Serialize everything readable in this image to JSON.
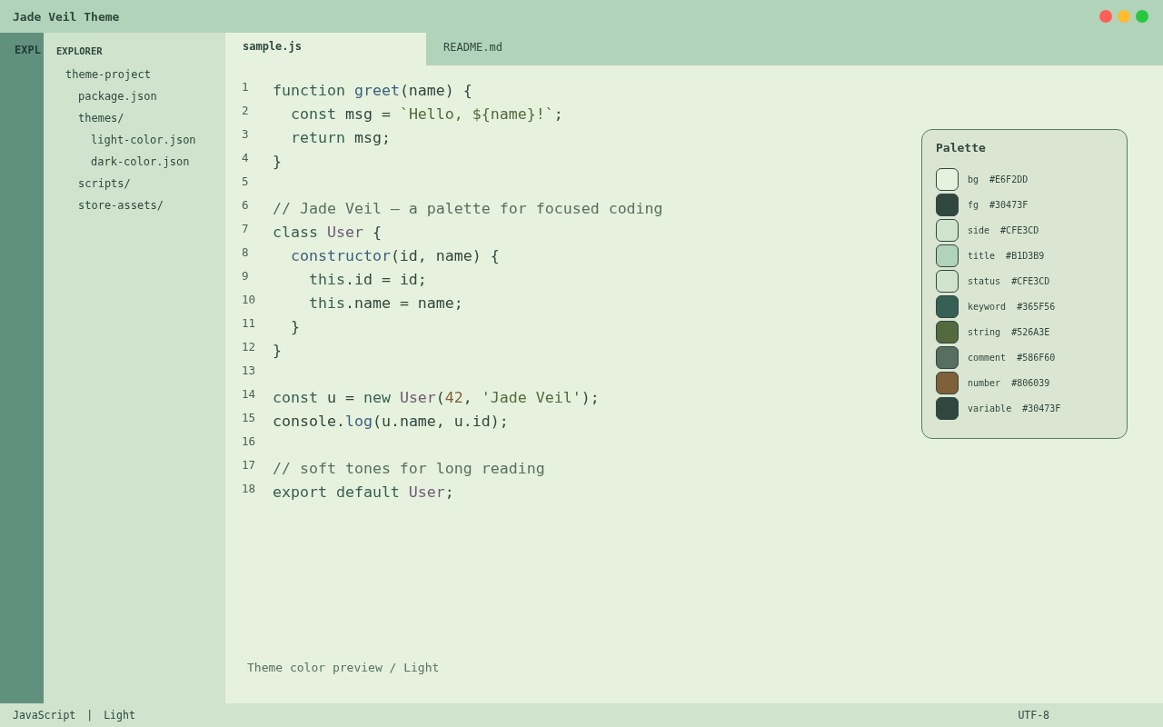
{
  "window": {
    "title": "Jade Veil Theme",
    "controls": [
      {
        "color": "#ff5f57"
      },
      {
        "color": "#febc2e"
      },
      {
        "color": "#28c840"
      }
    ]
  },
  "activity_bar": {
    "label": "EXPL"
  },
  "sidebar": {
    "heading": "EXPLORER",
    "items": [
      {
        "label": "theme-project",
        "children": [
          {
            "label": "package.json"
          },
          {
            "label": "themes/",
            "children": [
              {
                "label": "light-color.json"
              },
              {
                "label": "dark-color.json"
              }
            ]
          },
          {
            "label": "scripts/"
          },
          {
            "label": "store-assets/"
          }
        ]
      }
    ]
  },
  "tabs": [
    {
      "label": "sample.js",
      "selected": true
    },
    {
      "label": "README.md",
      "selected": false
    }
  ],
  "code": [
    {
      "number": "1",
      "tokens": [
        {
          "kind": "keyword",
          "text": "function "
        },
        {
          "kind": "function",
          "text": "greet"
        },
        {
          "kind": "plain",
          "text": "(name) {"
        }
      ]
    },
    {
      "number": "2",
      "tokens": [
        {
          "kind": "keyword",
          "text": "  const "
        },
        {
          "kind": "plain",
          "text": "msg = "
        },
        {
          "kind": "string",
          "text": "`Hello, ${name}!`"
        },
        {
          "kind": "plain",
          "text": ";"
        }
      ]
    },
    {
      "number": "3",
      "tokens": [
        {
          "kind": "keyword",
          "text": "  return "
        },
        {
          "kind": "plain",
          "text": "msg;"
        }
      ]
    },
    {
      "number": "4",
      "tokens": [
        {
          "kind": "plain",
          "text": "}"
        }
      ]
    },
    {
      "number": "5"
    },
    {
      "number": "6",
      "tokens": [
        {
          "kind": "comment",
          "text": "// Jade Veil — a palette for focused coding"
        }
      ]
    },
    {
      "number": "7",
      "tokens": [
        {
          "kind": "keyword",
          "text": "class "
        },
        {
          "kind": "class",
          "text": "User"
        },
        {
          "kind": "plain",
          "text": " {"
        }
      ]
    },
    {
      "number": "8",
      "tokens": [
        {
          "kind": "function",
          "text": "  constructor"
        },
        {
          "kind": "plain",
          "text": "(id, name) {"
        }
      ]
    },
    {
      "number": "9",
      "tokens": [
        {
          "kind": "keyword",
          "text": "    this"
        },
        {
          "kind": "plain",
          "text": ".id = id;"
        }
      ]
    },
    {
      "number": "10",
      "tokens": [
        {
          "kind": "keyword",
          "text": "    this"
        },
        {
          "kind": "plain",
          "text": ".name = name;"
        }
      ]
    },
    {
      "number": "11",
      "tokens": [
        {
          "kind": "plain",
          "text": "  }"
        }
      ]
    },
    {
      "number": "12",
      "tokens": [
        {
          "kind": "plain",
          "text": "}"
        }
      ]
    },
    {
      "number": "13"
    },
    {
      "number": "14",
      "tokens": [
        {
          "kind": "keyword",
          "text": "const "
        },
        {
          "kind": "plain",
          "text": "u = "
        },
        {
          "kind": "keyword",
          "text": "new "
        },
        {
          "kind": "class",
          "text": "User"
        },
        {
          "kind": "plain",
          "text": "("
        },
        {
          "kind": "number",
          "text": "42"
        },
        {
          "kind": "plain",
          "text": ", "
        },
        {
          "kind": "string",
          "text": "'Jade Veil'"
        },
        {
          "kind": "plain",
          "text": ");"
        }
      ]
    },
    {
      "number": "15",
      "tokens": [
        {
          "kind": "plain",
          "text": "console."
        },
        {
          "kind": "function",
          "text": "log"
        },
        {
          "kind": "plain",
          "text": "(u.name, u.id);"
        }
      ]
    },
    {
      "number": "16"
    },
    {
      "number": "17",
      "tokens": [
        {
          "kind": "comment",
          "text": "// soft tones for long reading"
        }
      ]
    },
    {
      "number": "18",
      "tokens": [
        {
          "kind": "keyword",
          "text": "export default "
        },
        {
          "kind": "class",
          "text": "User"
        },
        {
          "kind": "plain",
          "text": ";"
        }
      ]
    }
  ],
  "caption": "Theme color preview / Light",
  "palette": {
    "title": "Palette",
    "swatches": [
      {
        "name": "bg",
        "hex": "#E6F2DD",
        "color": "#e6f2dd"
      },
      {
        "name": "fg",
        "hex": "#30473F",
        "color": "#30473f"
      },
      {
        "name": "side",
        "hex": "#CFE3CD",
        "color": "#cfe3cd"
      },
      {
        "name": "title",
        "hex": "#B1D3B9",
        "color": "#b1d3b9"
      },
      {
        "name": "status",
        "hex": "#CFE3CD",
        "color": "#cfe3cd"
      },
      {
        "name": "keyword",
        "hex": "#365F56",
        "color": "#365f56"
      },
      {
        "name": "string",
        "hex": "#526A3E",
        "color": "#526a3e"
      },
      {
        "name": "comment",
        "hex": "#586F60",
        "color": "#586f60"
      },
      {
        "name": "number",
        "hex": "#806039",
        "color": "#806039"
      },
      {
        "name": "variable",
        "hex": "#30473F",
        "color": "#30473f"
      }
    ]
  },
  "status_bar": {
    "left": [
      "JavaScript",
      "|",
      "Light"
    ],
    "right": "UTF-8"
  }
}
